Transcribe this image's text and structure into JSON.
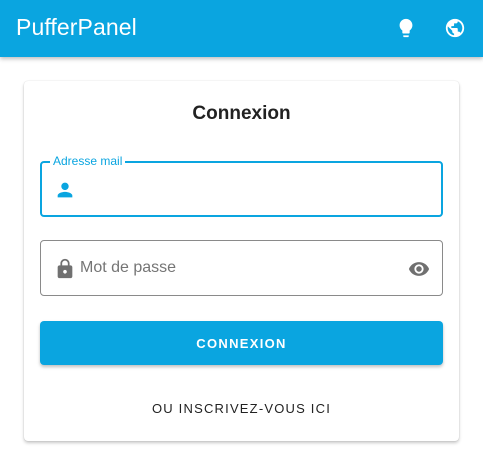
{
  "app_bar": {
    "title": "PufferPanel",
    "icons": [
      "lightbulb-icon",
      "globe-icon"
    ],
    "color": "#0aa5e0"
  },
  "login_card": {
    "title": "Connexion",
    "email_field": {
      "label": "Adresse mail",
      "value": "",
      "icon": "account-icon"
    },
    "password_field": {
      "placeholder": "Mot de passe",
      "value": "",
      "icon": "lock-icon",
      "toggle_icon": "eye-icon"
    },
    "login_button": "CONNEXION",
    "register_link": "OU INSCRIVEZ-VOUS ICI"
  }
}
